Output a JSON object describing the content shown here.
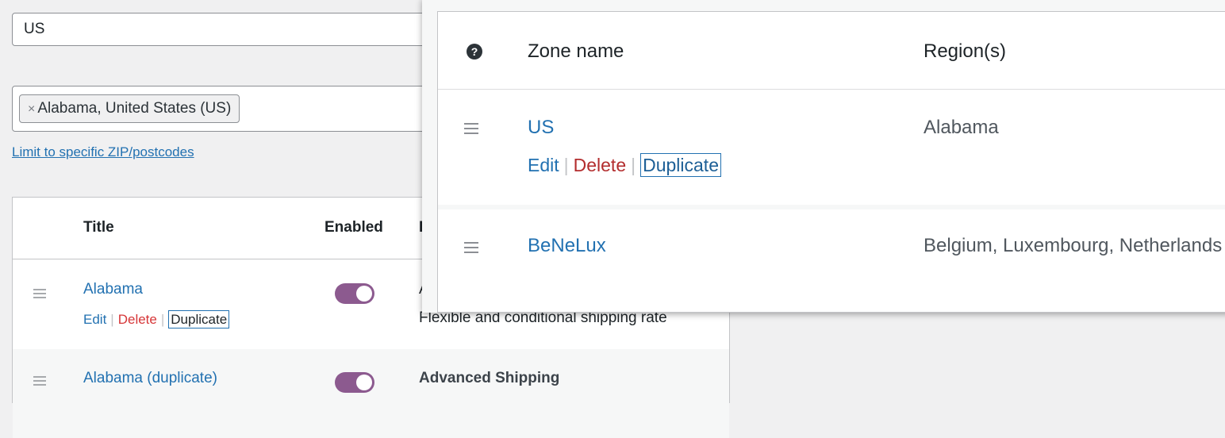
{
  "zone_form": {
    "zone_name_value": "US",
    "region_tag": "Alabama, United States (US)",
    "region_tag_remove": "×",
    "postcodes_link": "Limit to specific ZIP/postcodes"
  },
  "methods_table": {
    "headers": {
      "title": "Title",
      "enabled": "Enabled",
      "partial": "I"
    },
    "rows": [
      {
        "title": "Alabama",
        "edit": "Edit",
        "delete": "Delete",
        "duplicate": "Duplicate",
        "enabled": true,
        "method_partial": "A",
        "description": "Flexible and conditional shipping rate"
      },
      {
        "title": "Alabama (duplicate)",
        "enabled": true,
        "method": "Advanced Shipping"
      }
    ]
  },
  "zones_panel": {
    "help_icon": "?",
    "headers": {
      "zone_name": "Zone name",
      "regions": "Region(s)"
    },
    "rows": [
      {
        "name": "US",
        "regions": "Alabama",
        "edit": "Edit",
        "delete": "Delete",
        "duplicate": "Duplicate"
      },
      {
        "name": "BeNeLux",
        "regions": "Belgium, Luxembourg, Netherlands"
      }
    ]
  },
  "colors": {
    "link": "#2271b1",
    "delete": "#d63638",
    "toggle_on": "#8c5a8f"
  }
}
